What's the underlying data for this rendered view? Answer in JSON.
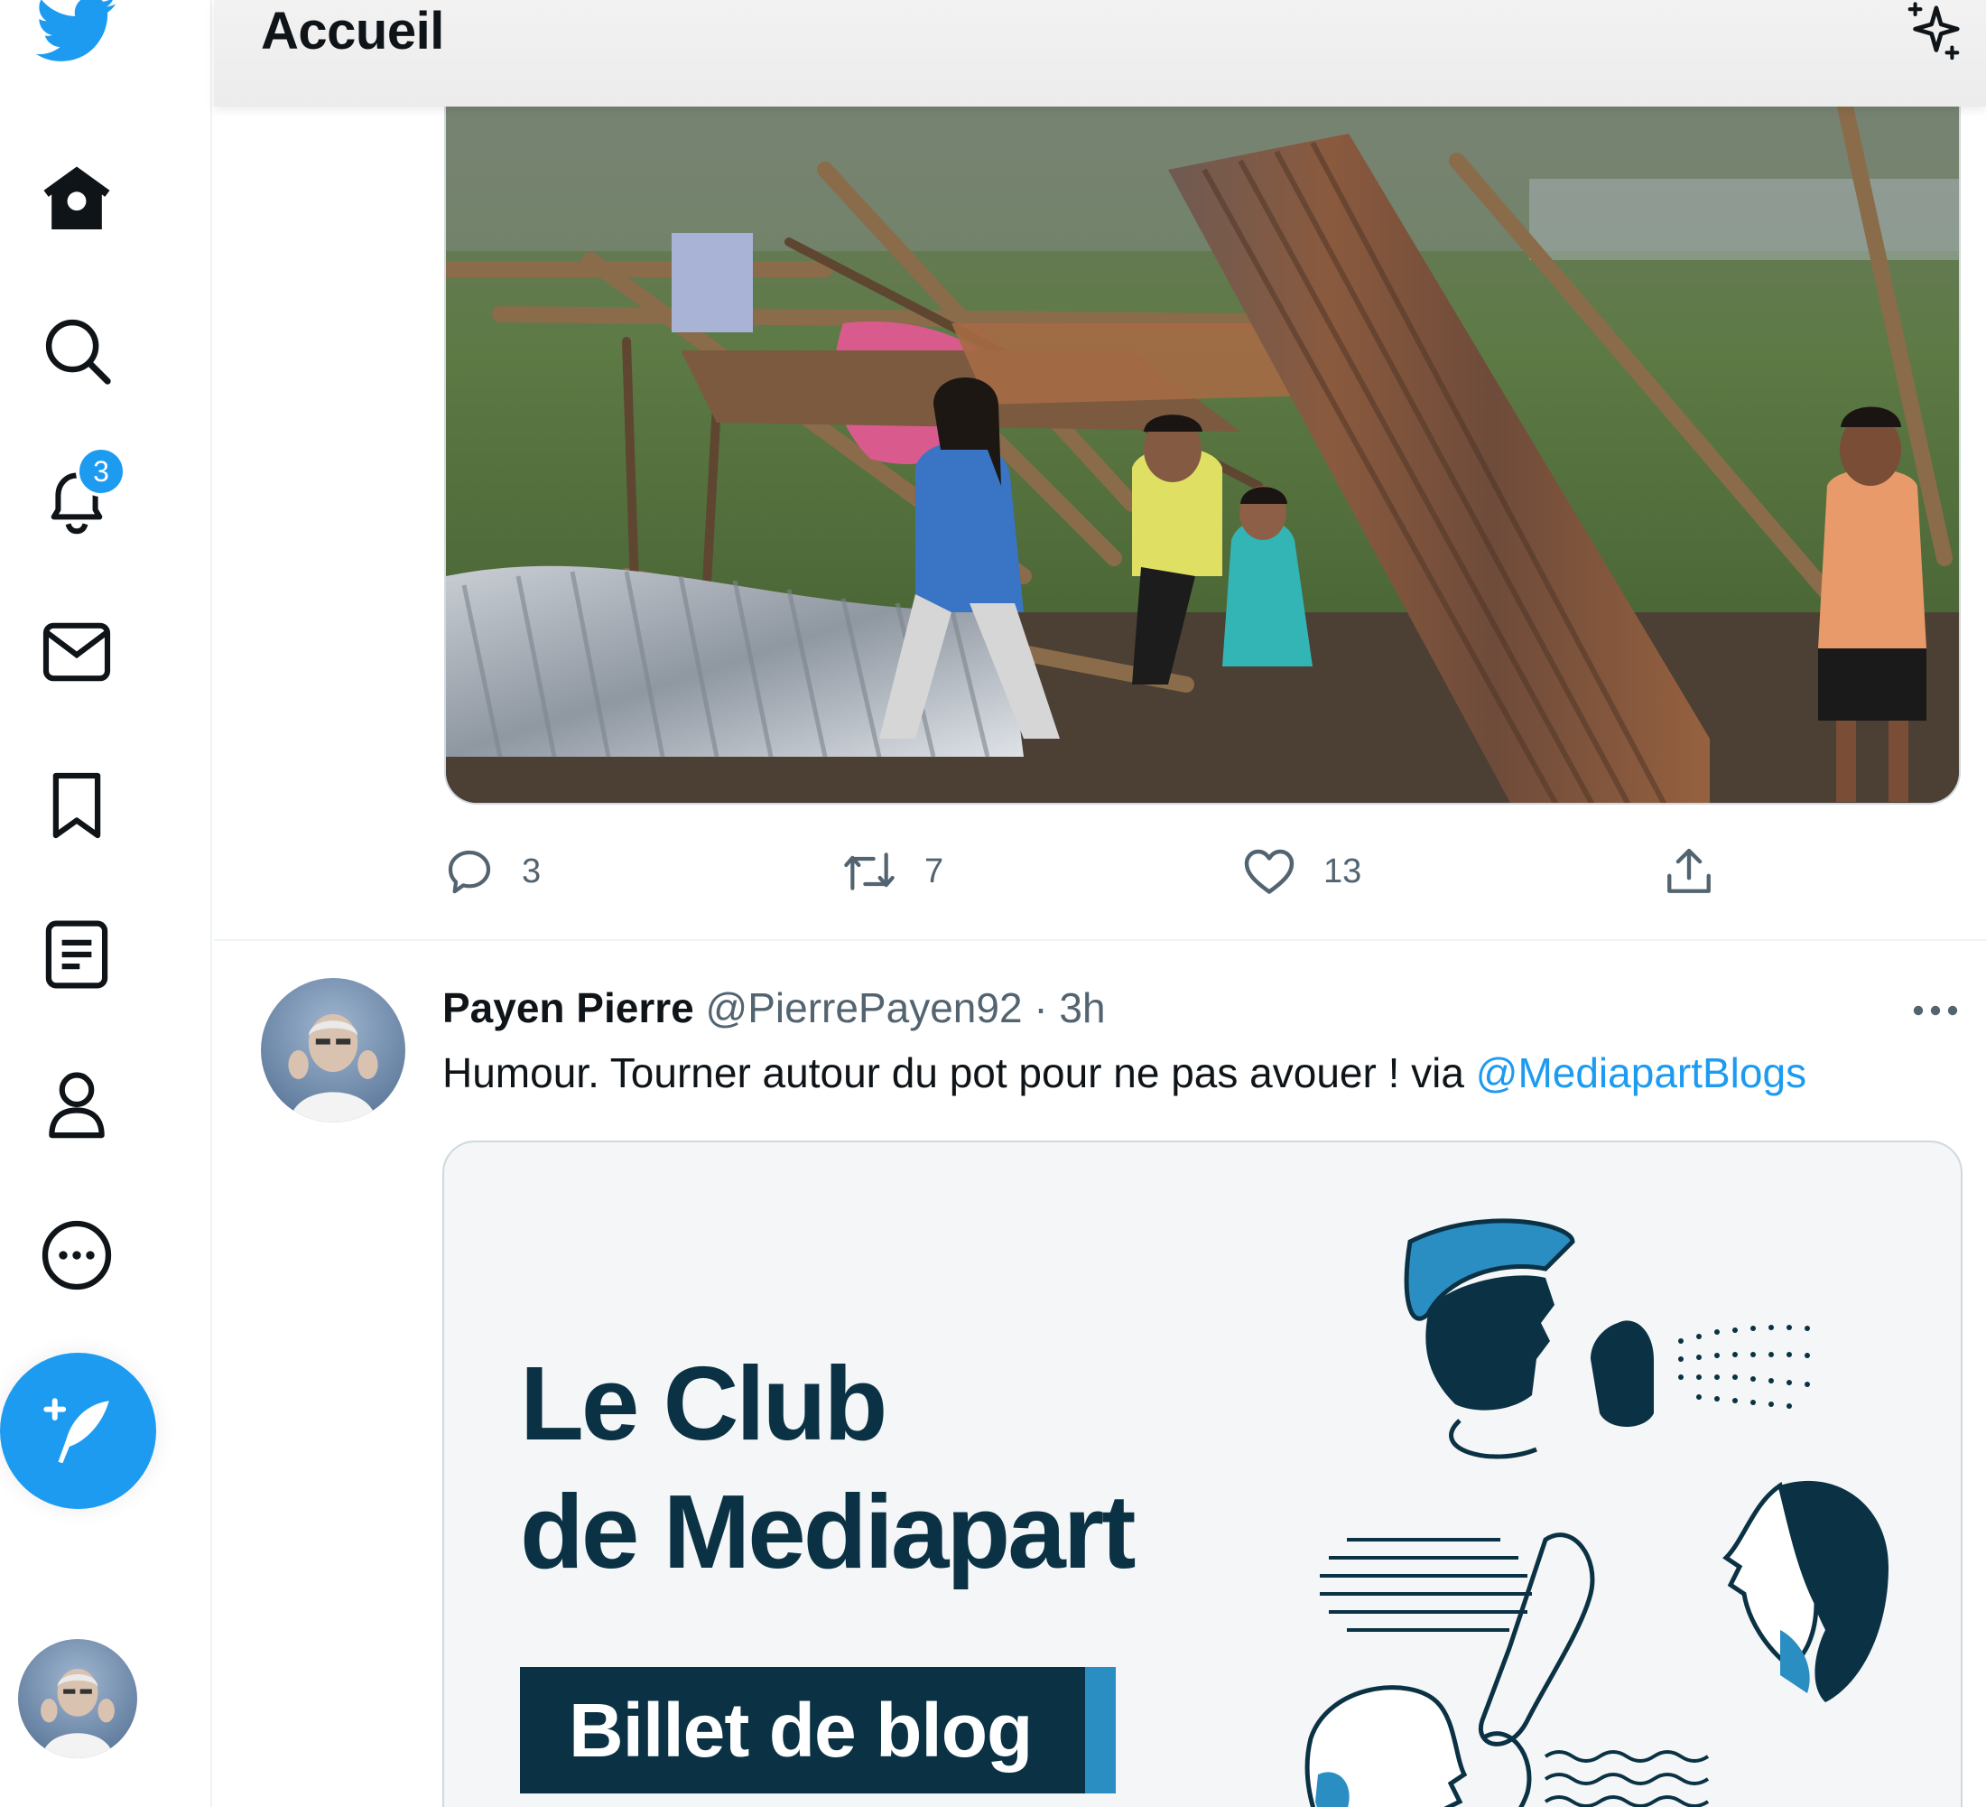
{
  "app": {
    "accent_color": "#1d9bf0",
    "logo_icon": "twitter-bird-icon"
  },
  "sidebar": {
    "items": [
      {
        "name": "home",
        "icon": "home-icon"
      },
      {
        "name": "explore",
        "icon": "search-icon"
      },
      {
        "name": "notifications",
        "icon": "bell-icon",
        "badge": "3"
      },
      {
        "name": "messages",
        "icon": "envelope-icon"
      },
      {
        "name": "bookmarks",
        "icon": "bookmark-icon"
      },
      {
        "name": "lists",
        "icon": "list-icon"
      },
      {
        "name": "profile",
        "icon": "person-icon"
      },
      {
        "name": "more",
        "icon": "more-circle-icon"
      }
    ],
    "compose_icon": "compose-feather-icon"
  },
  "header": {
    "title": "Accueil",
    "sparkle_icon": "sparkle-icon"
  },
  "previous_tweet": {
    "media_icon": "photo",
    "stats": {
      "replies": "3",
      "retweets": "7",
      "likes": "13"
    }
  },
  "tweet": {
    "display_name": "Payen Pierre",
    "handle": "@PierrePayen92",
    "separator": "·",
    "time": "3h",
    "text": "Humour. Tourner autour du pot pour ne pas avouer ! via ",
    "mention": "@MediapartBlogs",
    "card": {
      "title_line1": "Le Club",
      "title_line2": "de Mediapart",
      "pill_label": "Billet de blog",
      "brand_dark": "#0b3244",
      "brand_blue": "#2b8ec2"
    }
  }
}
